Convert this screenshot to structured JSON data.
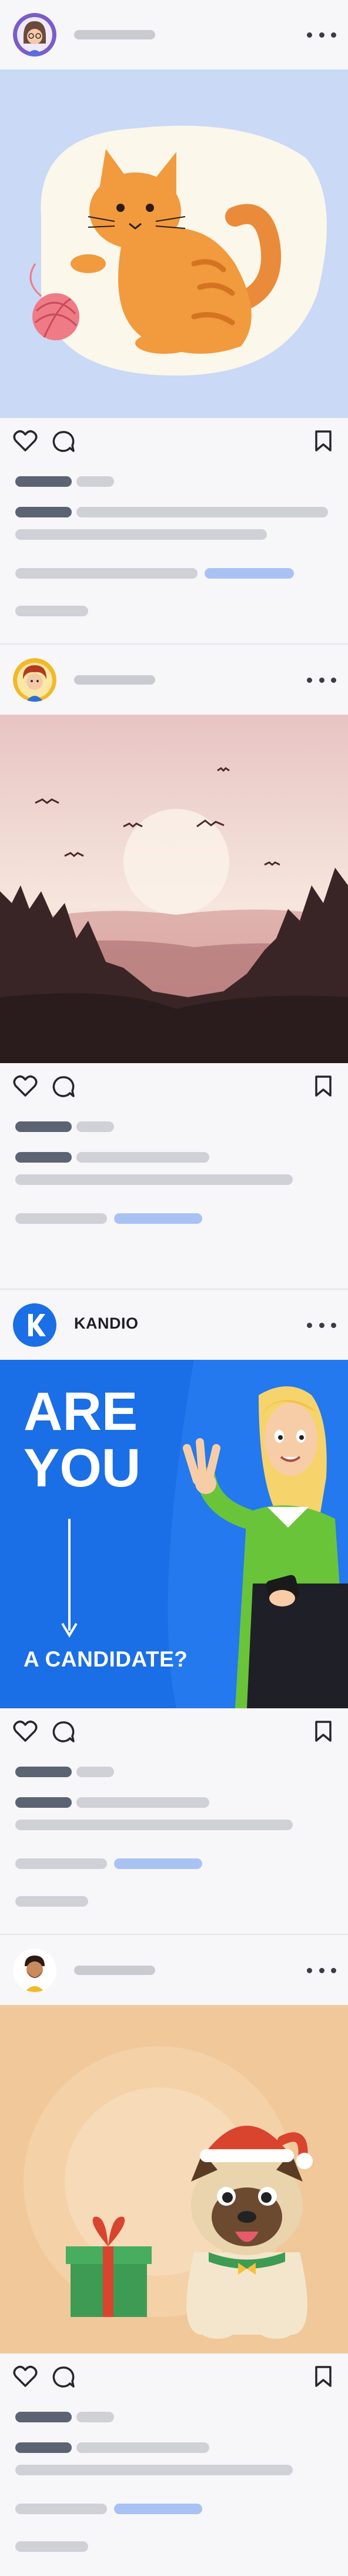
{
  "feed": {
    "posts": [
      {
        "avatar_icon": "illustrated-avatar-woman-glasses",
        "media_icon": "orange-cat-with-yarn-illustration"
      },
      {
        "avatar_icon": "illustrated-avatar-man-curly-hair",
        "media_icon": "misty-forest-sunrise-with-birds"
      },
      {
        "avatar_icon": "kandio-logo-k",
        "username": "KANDIO",
        "ad": {
          "line1": "ARE",
          "line2": "YOU",
          "line3": "A CANDIDATE?",
          "accent": "#1a6ee6"
        }
      },
      {
        "avatar_icon": "illustrated-avatar-man-beard",
        "media_icon": "pug-with-santa-hat-and-gift-illustration"
      }
    ]
  },
  "colors": {
    "background": "#f7f7f9",
    "accent_blue": "#a9c2f4",
    "placeholder": "#cfd1d7"
  }
}
